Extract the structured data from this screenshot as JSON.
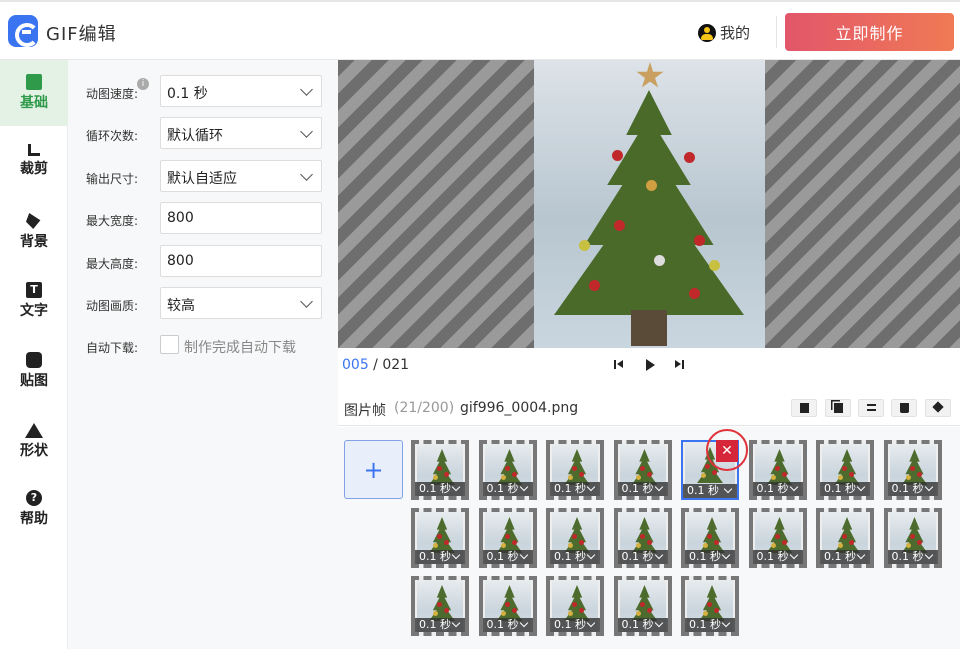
{
  "header": {
    "app_title": "GIF编辑",
    "user_label": "我的",
    "make_button": "立即制作"
  },
  "nav": {
    "items": [
      {
        "label": "基础",
        "icon": "folder-icon",
        "active": true
      },
      {
        "label": "裁剪",
        "icon": "crop-icon"
      },
      {
        "label": "背景",
        "icon": "paint-bucket-icon"
      },
      {
        "label": "文字",
        "icon": "text-icon"
      },
      {
        "label": "贴图",
        "icon": "sticker-icon"
      },
      {
        "label": "形状",
        "icon": "triangle-icon"
      },
      {
        "label": "帮助",
        "icon": "help-icon"
      }
    ]
  },
  "settings": {
    "speed": {
      "label": "动图速度:",
      "value": "0.1 秒"
    },
    "loop": {
      "label": "循环次数:",
      "value": "默认循环"
    },
    "size": {
      "label": "输出尺寸:",
      "value": "默认自适应"
    },
    "max_width": {
      "label": "最大宽度:",
      "value": "800"
    },
    "max_height": {
      "label": "最大高度:",
      "value": "800"
    },
    "quality": {
      "label": "动图画质:",
      "value": "较高"
    },
    "auto_download": {
      "label": "自动下载:",
      "checkbox_label": "制作完成自动下载",
      "checked": false
    }
  },
  "player": {
    "current_frame": "005",
    "separator": " / ",
    "total_frames": "021"
  },
  "frames_panel": {
    "title": "图片帧",
    "count": "(21/200)",
    "filename": "gif996_0004.png",
    "frame_duration": "0.1 秒",
    "selected_index": 4,
    "add_label": "+",
    "delete_label": "✕"
  },
  "colors": {
    "accent": "#3a74f0",
    "nav_active": "#2e9a4a",
    "make_button_start": "#e2566a",
    "make_button_end": "#f07a55",
    "delete": "#d6263a"
  }
}
